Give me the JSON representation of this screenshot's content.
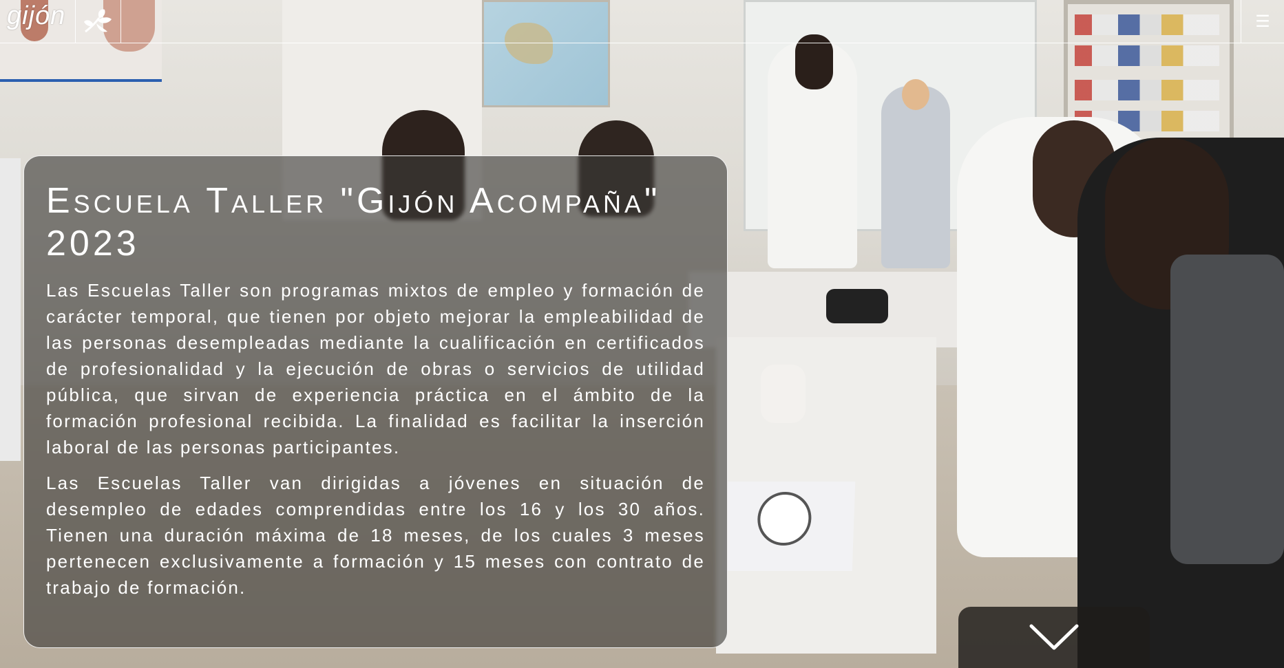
{
  "header": {
    "logo_text": "gijón",
    "menu_icon": "hamburger-icon"
  },
  "hero": {
    "title": "Escuela Taller \"Gijón Acompaña\" 2023",
    "paragraphs": [
      "Las Escuelas Taller son programas mixtos de empleo y formación de carácter temporal, que tienen por objeto mejorar la empleabilidad de las personas desempleadas mediante la cualificación en certificados de profesionalidad y la ejecución de obras o servicios de utilidad pública, que sirvan de experiencia práctica en el ámbito de la formación profesional recibida. La finalidad es facilitar la inserción laboral de las personas participantes.",
      "Las Escuelas Taller van dirigidas a jóvenes en situación de desempleo de edades comprendidas entre los 16 y los 30 años. Tienen una duración máxima de 18 meses, de los cuales 3 meses pertenecen exclusivamente a formación y 15 meses con contrato de trabajo de formación."
    ]
  },
  "scroll": {
    "icon": "chevron-down-icon"
  }
}
